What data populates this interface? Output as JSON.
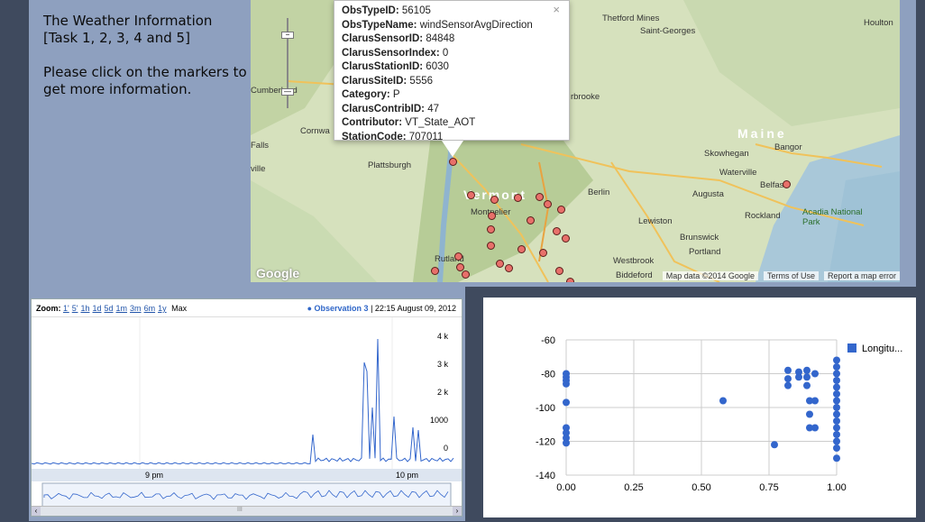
{
  "info": {
    "title": "The Weather Information [Task 1, 2, 3, 4 and 5]",
    "hint": "Please click on the markers to get more information."
  },
  "popup": {
    "rows": [
      {
        "key": "ObsTypeID:",
        "value": "56105"
      },
      {
        "key": "ObsTypeName:",
        "value": "windSensorAvgDirection"
      },
      {
        "key": "ClarusSensorID:",
        "value": "84848"
      },
      {
        "key": "ClarusSensorIndex:",
        "value": "0"
      },
      {
        "key": "ClarusStationID:",
        "value": "6030"
      },
      {
        "key": "ClarusSiteID:",
        "value": "5556"
      },
      {
        "key": "Category:",
        "value": "P"
      },
      {
        "key": "ClarusContribID:",
        "value": "47"
      },
      {
        "key": "Contributor:",
        "value": "VT_State_AOT"
      },
      {
        "key": "StationCode:",
        "value": "707011"
      }
    ],
    "close": "×"
  },
  "map": {
    "labels": {
      "thetford": "Thetford Mines",
      "saint_georges": "Saint-Georges",
      "houlton": "Houlton",
      "cumberland": "Cumberland",
      "sherbrooke": "rbrooke",
      "cornwall": "Cornwa",
      "falls": "Falls",
      "ville": "ville",
      "plattsburgh": "Plattsburgh",
      "vermont": "Vermont",
      "montpelier": "Montpelier",
      "berlin": "Berlin",
      "maine": "Maine",
      "skowhegan": "Skowhegan",
      "bangor": "Bangor",
      "waterville": "Waterville",
      "belfast": "Belfast",
      "augusta": "Augusta",
      "lewiston": "Lewiston",
      "rockland": "Rockland",
      "acadia": "Acadia National Park",
      "brunswick": "Brunswick",
      "portland": "Portland",
      "rutland": "Rutland",
      "westbrook": "Westbrook",
      "biddeford": "Biddeford"
    },
    "footer": {
      "data": "Map data ©2014 Google",
      "terms": "Terms of Use",
      "report": "Report a map error"
    },
    "google": "Google"
  },
  "stock": {
    "zoom_label": "Zoom:",
    "zoom_options": [
      "1'",
      "5'",
      "1h",
      "1d",
      "5d",
      "1m",
      "3m",
      "6m",
      "1y"
    ],
    "zoom_max": "Max",
    "series_name": "Observation 3",
    "timestamp": "| 22:15 August 09, 2012",
    "y_ticks": [
      "4 k",
      "3 k",
      "2 k",
      "1000",
      "0"
    ],
    "x_ticks": [
      "9 pm",
      "10 pm"
    ],
    "scrollbar_mid": "III"
  },
  "chart_data": {
    "type": "scatter",
    "title": "",
    "xlabel": "",
    "ylabel": "",
    "xlim": [
      0,
      1
    ],
    "ylim": [
      -140,
      -60
    ],
    "x_ticks": [
      "0.00",
      "0.25",
      "0.50",
      "0.75",
      "1.00"
    ],
    "y_ticks": [
      "-60",
      "-80",
      "-100",
      "-120",
      "-140"
    ],
    "legend_position": "top-right",
    "series": [
      {
        "name": "Longitu...",
        "color": "#3366cc",
        "points": [
          [
            0,
            -80
          ],
          [
            0,
            -82
          ],
          [
            0,
            -84
          ],
          [
            0,
            -86
          ],
          [
            0,
            -97
          ],
          [
            0,
            -112
          ],
          [
            0,
            -115
          ],
          [
            0,
            -118
          ],
          [
            0,
            -121
          ],
          [
            0.58,
            -96
          ],
          [
            0.77,
            -122
          ],
          [
            0.82,
            -78
          ],
          [
            0.82,
            -83
          ],
          [
            0.82,
            -87
          ],
          [
            0.86,
            -79
          ],
          [
            0.86,
            -82
          ],
          [
            0.89,
            -78
          ],
          [
            0.89,
            -82
          ],
          [
            0.89,
            -87
          ],
          [
            0.9,
            -96
          ],
          [
            0.9,
            -104
          ],
          [
            0.9,
            -112
          ],
          [
            0.92,
            -80
          ],
          [
            0.92,
            -96
          ],
          [
            0.92,
            -112
          ],
          [
            1.0,
            -72
          ],
          [
            1.0,
            -76
          ],
          [
            1.0,
            -80
          ],
          [
            1.0,
            -84
          ],
          [
            1.0,
            -88
          ],
          [
            1.0,
            -92
          ],
          [
            1.0,
            -96
          ],
          [
            1.0,
            -100
          ],
          [
            1.0,
            -104
          ],
          [
            1.0,
            -108
          ],
          [
            1.0,
            -112
          ],
          [
            1.0,
            -116
          ],
          [
            1.0,
            -120
          ],
          [
            1.0,
            -124
          ],
          [
            1.0,
            -130
          ]
        ]
      }
    ]
  }
}
